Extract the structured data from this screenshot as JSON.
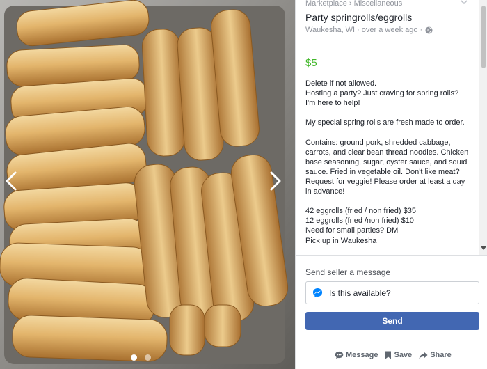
{
  "breadcrumb": {
    "root": "Marketplace",
    "separator": "›",
    "category": "Miscellaneous"
  },
  "listing": {
    "title": "Party springrolls/eggrolls",
    "location": "Waukesha, WI",
    "meta_separator": "·",
    "posted": "over a week ago",
    "price": "$5",
    "description": "Delete if not allowed.\nHosting a party? Just craving for spring rolls? I'm here to help!\n\nMy special spring rolls are fresh made to order.\n\nContains: ground pork, shredded cabbage, carrots, and clear bean thread noodles. Chicken base seasoning, sugar, oyster sauce, and squid sauce. Fried in vegetable oil. Don't like meat? Request for veggie! Please order at least a day in advance!\n\n42 eggrolls (fried / non fried) $35\n12 eggrolls (fried /non fried) $10\nNeed for small parties? DM\nPick up in Waukesha",
    "price_color": "#42b72a"
  },
  "message": {
    "heading": "Send seller a message",
    "input_value": "Is this available?",
    "send_label": "Send",
    "send_color": "#4267b2"
  },
  "actions": {
    "message": "Message",
    "save": "Save",
    "share": "Share"
  },
  "viewer": {
    "photo_count": 2,
    "active_index": 0
  },
  "icons": [
    "chevron-down-icon",
    "globe-icon",
    "messenger-icon",
    "speech-bubble-icon",
    "bookmark-icon",
    "share-arrow-icon",
    "prev-arrow-icon",
    "next-arrow-icon"
  ]
}
